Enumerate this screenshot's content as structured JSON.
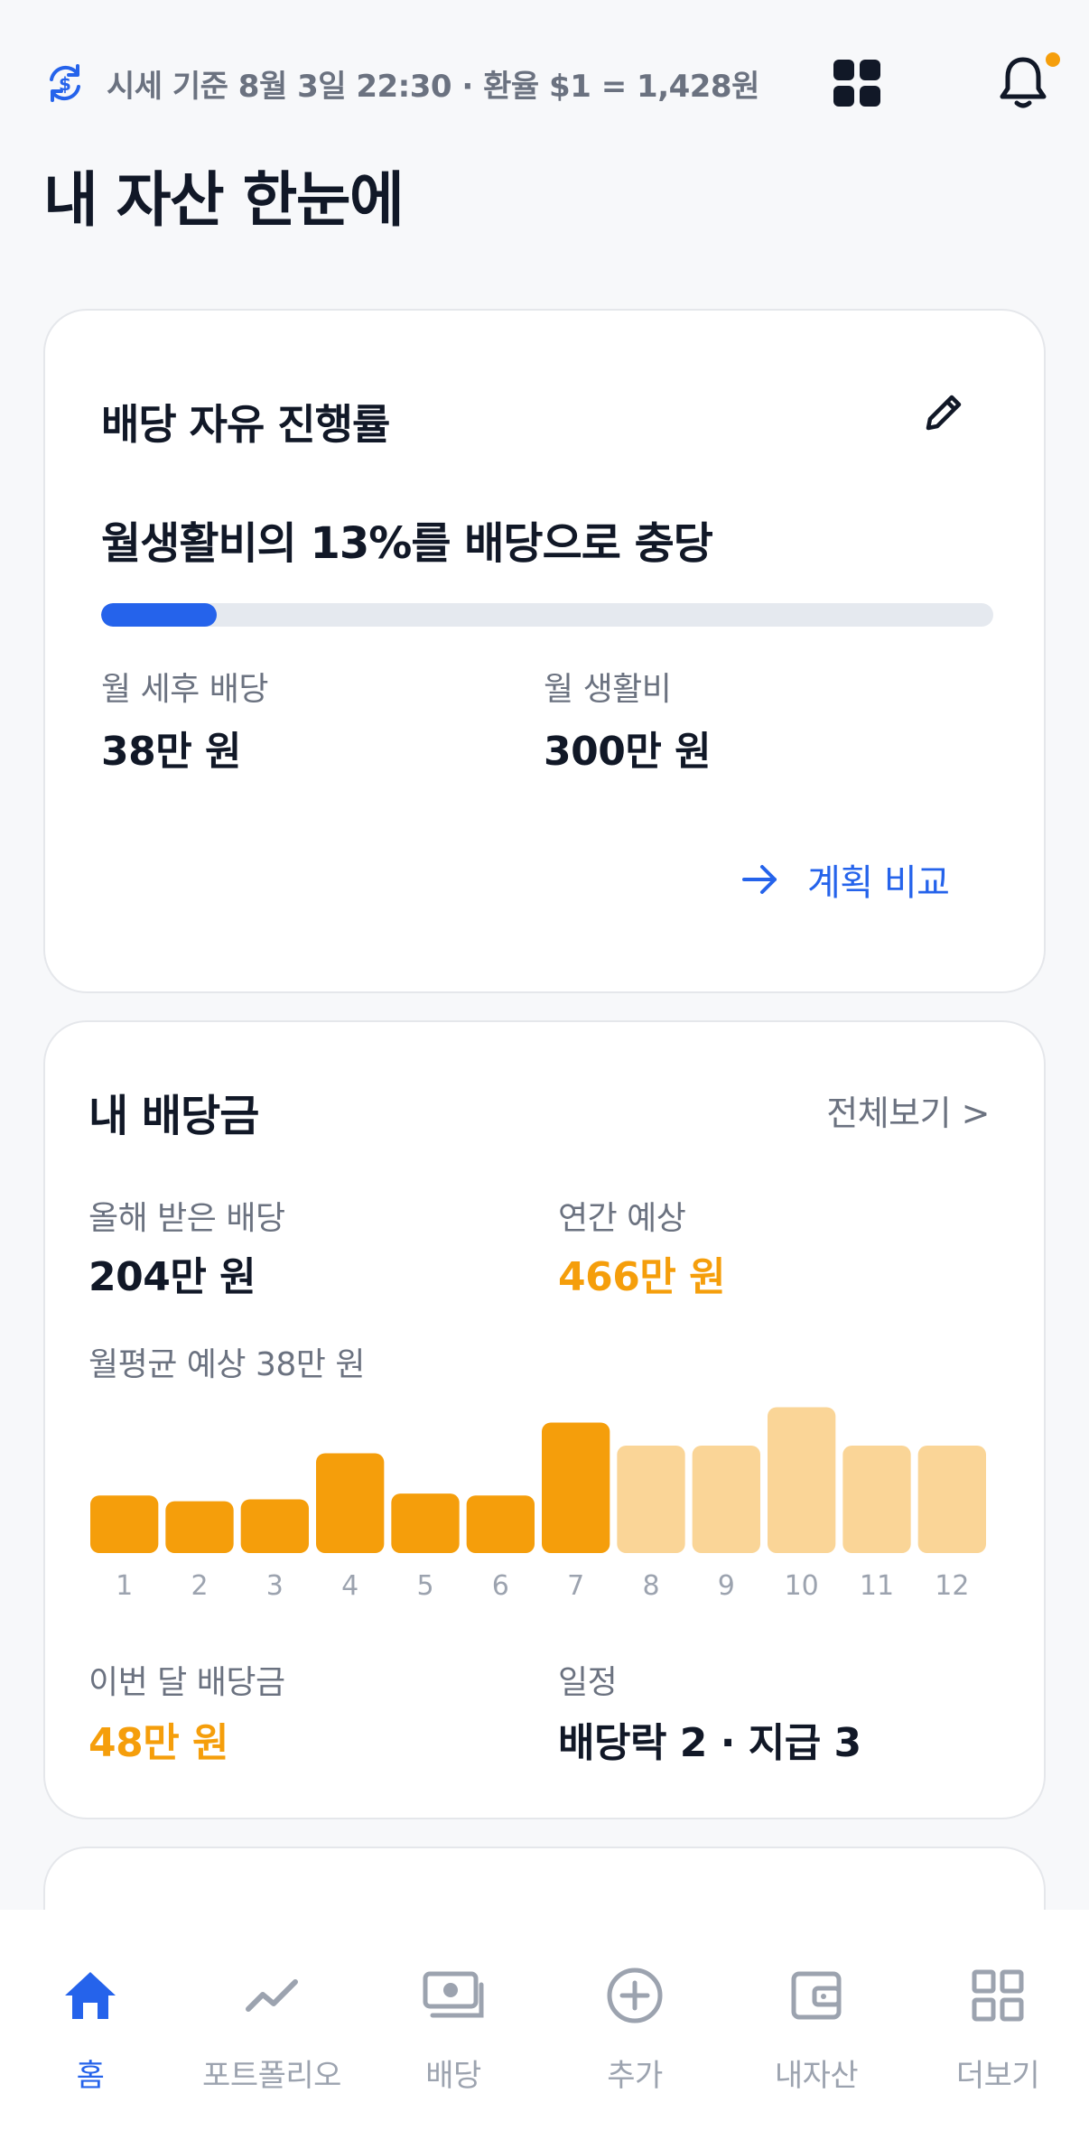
{
  "header": {
    "rate_text": "시세 기준 8월 3일 22:30 · 환율 $1 = 1,428원",
    "title": "내 자산 한눈에"
  },
  "icons": {
    "refresh": "currency-refresh-icon",
    "grid": "grid-icon",
    "bell": "bell-icon",
    "edit": "pencil-icon",
    "arrow": "arrow-right-icon"
  },
  "colors": {
    "accent": "#2563eb",
    "orange": "#f59e0b",
    "orange_light": "#fad597",
    "text": "#111827",
    "muted": "#6b7280"
  },
  "freedom_card": {
    "title": "배당 자유 진행률",
    "headline": "월생활비의 13%를 배당으로 충당",
    "progress_percent": 13,
    "after_tax_label": "월 세후 배당",
    "after_tax_value": "38만 원",
    "living_label": "월 생활비",
    "living_value": "300만 원",
    "compare_label": "계획 비교"
  },
  "dividend_card": {
    "title": "내 배당금",
    "view_all": "전체보기 >",
    "received_label": "올해 받은 배당",
    "received_value": "204만 원",
    "annual_label": "연간 예상",
    "annual_value": "466만 원",
    "monthly_avg": "월평균 예상 38만 원",
    "this_month_label": "이번 달 배당금",
    "this_month_value": "48만 원",
    "schedule_label": "일정",
    "schedule_value": "배당락 2 · 지급 3"
  },
  "chart_data": {
    "type": "bar",
    "categories": [
      "1",
      "2",
      "3",
      "4",
      "5",
      "6",
      "7",
      "8",
      "9",
      "10",
      "11",
      "12"
    ],
    "values": [
      30,
      27,
      28,
      52,
      31,
      30,
      68,
      56,
      56,
      76,
      56,
      56
    ],
    "received_through_index": 6,
    "ylim": [
      0,
      80
    ],
    "grid": false
  },
  "nav": [
    {
      "label": "홈",
      "icon": "home-icon",
      "active": true
    },
    {
      "label": "포트폴리오",
      "icon": "trend-line-icon",
      "active": false
    },
    {
      "label": "배당",
      "icon": "cash-icon",
      "active": false
    },
    {
      "label": "추가",
      "icon": "plus-circle-icon",
      "active": false
    },
    {
      "label": "내자산",
      "icon": "wallet-icon",
      "active": false
    },
    {
      "label": "더보기",
      "icon": "grid-more-icon",
      "active": false
    }
  ]
}
